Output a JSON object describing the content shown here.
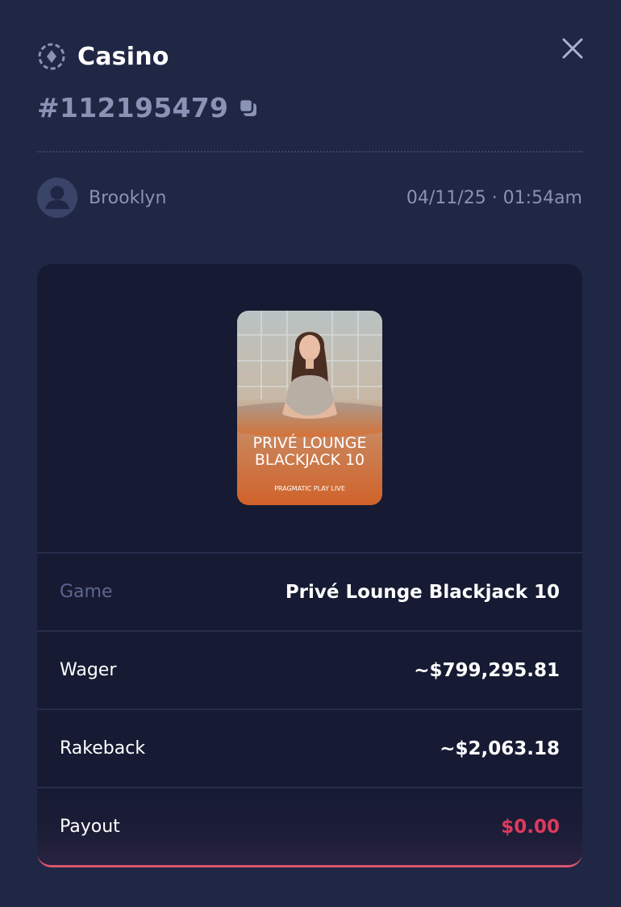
{
  "header": {
    "title": "Casino",
    "bet_id": "#112195479"
  },
  "user": {
    "name": "Brooklyn",
    "timestamp": "04/11/25 · 01:54am"
  },
  "game_thumbnail": {
    "line1": "PRIVÉ LOUNGE",
    "line2": "BLACKJACK 10",
    "provider": "PRAGMATIC PLAY LIVE"
  },
  "details": {
    "game_label": "Game",
    "game_value": "Privé Lounge Blackjack 10",
    "wager_label": "Wager",
    "wager_value": "~$799,295.81",
    "rakeback_label": "Rakeback",
    "rakeback_value": "~$2,063.18",
    "payout_label": "Payout",
    "payout_value": "$0.00"
  },
  "colors": {
    "background": "#1f2744",
    "card": "#161b33",
    "muted_text": "#8a92b5",
    "payout_red": "#e0395e"
  }
}
